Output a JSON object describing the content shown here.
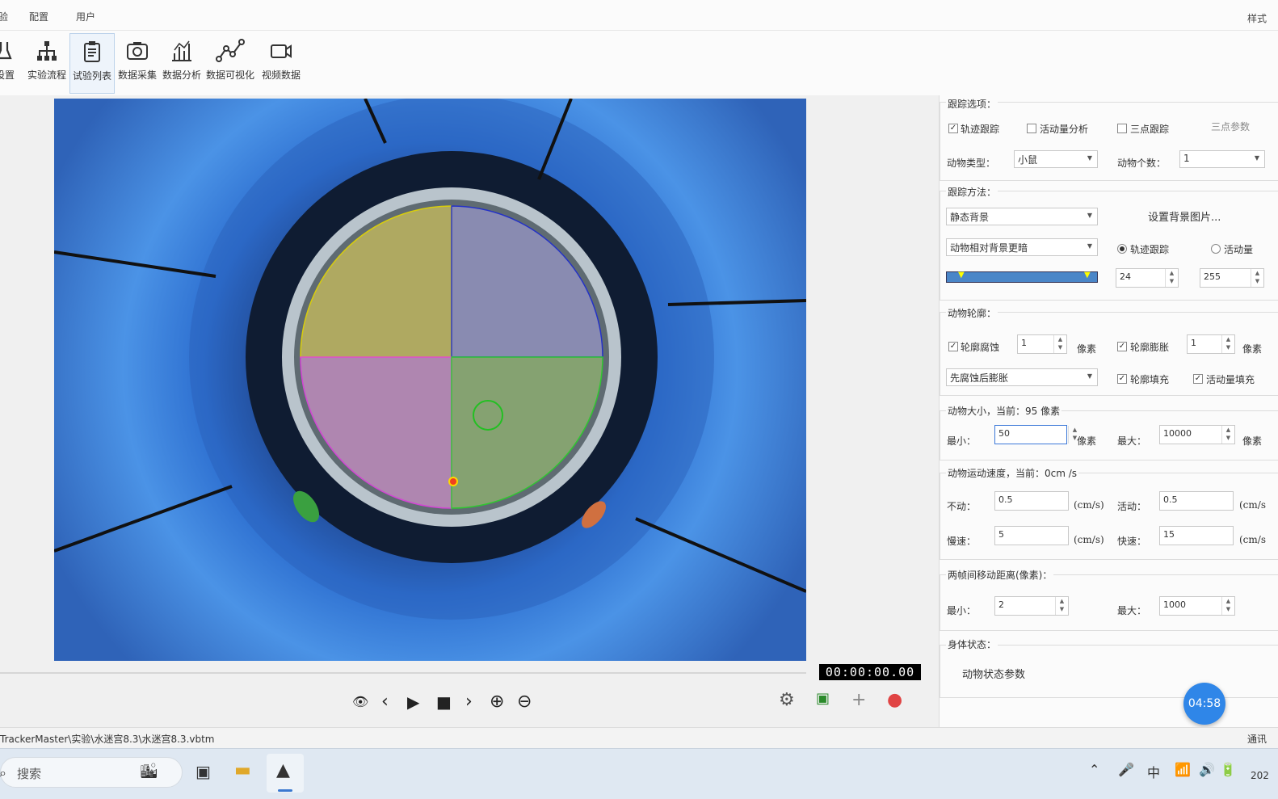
{
  "menu": {
    "tabs": [
      "验",
      "配置",
      "用户"
    ],
    "right": "样式"
  },
  "toolbar": {
    "items": [
      {
        "label": "设置",
        "icon": "beaker-icon"
      },
      {
        "label": "实验流程",
        "icon": "hierarchy-icon"
      },
      {
        "label": "试验列表",
        "icon": "clipboard-icon"
      },
      {
        "label": "数据采集",
        "icon": "camera-icon"
      },
      {
        "label": "数据分析",
        "icon": "chart-icon"
      },
      {
        "label": "数据可视化",
        "icon": "graph-icon"
      },
      {
        "label": "视频数据",
        "icon": "video-icon"
      }
    ]
  },
  "video": {
    "timecode": "00:00:00.00"
  },
  "panel": {
    "tracking": {
      "title": "跟踪选项：",
      "track": "轨迹跟踪",
      "activity": "活动量分析",
      "three_point": "三点跟踪",
      "three_point_params": "三点参数",
      "animal_type_label": "动物类型：",
      "animal_type": "小鼠",
      "animal_count_label": "动物个数：",
      "animal_count": "1"
    },
    "method": {
      "title": "跟踪方法：",
      "background": "静态背景",
      "set_bg": "设置背景图片...",
      "contrast": "动物相对背景更暗",
      "radio_track": "轨迹跟踪",
      "radio_activity": "活动量",
      "low": "24",
      "high": "255"
    },
    "contour": {
      "title": "动物轮廓：",
      "erode": "轮廓腐蚀",
      "erode_val": "1",
      "pixel": "像素",
      "dilate": "轮廓膨胀",
      "dilate_val": "1",
      "order": "先腐蚀后膨胀",
      "fill": "轮廓填充",
      "activity_fill": "活动量填充"
    },
    "size": {
      "title": "动物大小，当前：95 像素",
      "min_label": "最小：",
      "min": "50",
      "max_label": "最大：",
      "max": "10000",
      "pixel": "像素"
    },
    "speed": {
      "title": "动物运动速度，当前：0cm /s",
      "still_label": "不动：",
      "still": "0.5",
      "active_label": "活动：",
      "active": "0.5",
      "slow_label": "慢速：",
      "slow": "5",
      "fast_label": "快速：",
      "fast": "15",
      "unit": "(cm/s)",
      "unit_cut": "(cm/s"
    },
    "distance": {
      "title": "两帧间移动距离(像素)：",
      "min_label": "最小：",
      "min": "2",
      "max_label": "最大：",
      "max": "1000"
    },
    "body": {
      "title": "身体状态：",
      "params": "动物状态参数"
    }
  },
  "clock": "04:58",
  "status": {
    "path": "TrackerMaster\\实验\\水迷宫8.3\\水迷宫8.3.vbtm",
    "right": "通讯"
  },
  "taskbar": {
    "search": "搜索",
    "ime": "中",
    "date": "202"
  }
}
